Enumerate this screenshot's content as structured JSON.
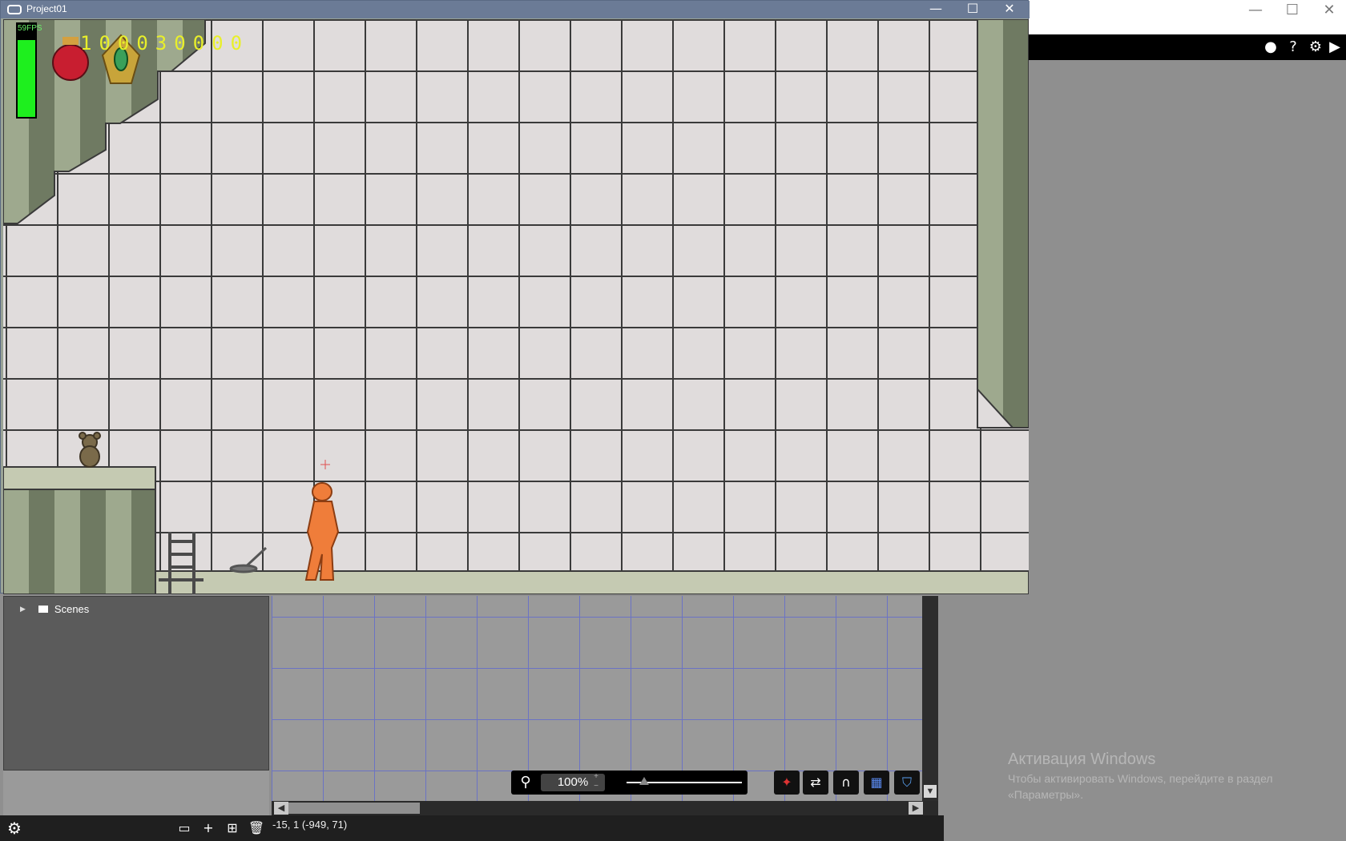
{
  "game_window": {
    "title": "Project01",
    "controls": {
      "minimize": "—",
      "maximize": "☐",
      "close": "✕"
    },
    "hud": {
      "fps_label": "FPS",
      "fps_value": "59",
      "score": "100030000"
    }
  },
  "editor": {
    "window_controls": {
      "minimize": "—",
      "maximize": "☐",
      "close": "✕"
    },
    "toolbar": [
      "help-icon",
      "gear-icon",
      "play-icon"
    ],
    "scenes_panel": {
      "root_label": "Scenes"
    },
    "zoom": {
      "value": "100%"
    },
    "status": {
      "coords": "-15, 1 (-949, 71)"
    },
    "watermark": {
      "title": "Активация Windows",
      "text": "Чтобы активировать Windows, перейдите в раздел «Параметры»."
    }
  },
  "colors": {
    "wall": "#e0dcdc",
    "grid": "#3a3a3a",
    "stripe_light": "#9ea98e",
    "stripe_dark": "#6f7a62",
    "floor": "#c5cab2",
    "player": "#ef7d3a",
    "score": "#e8ef2a"
  }
}
